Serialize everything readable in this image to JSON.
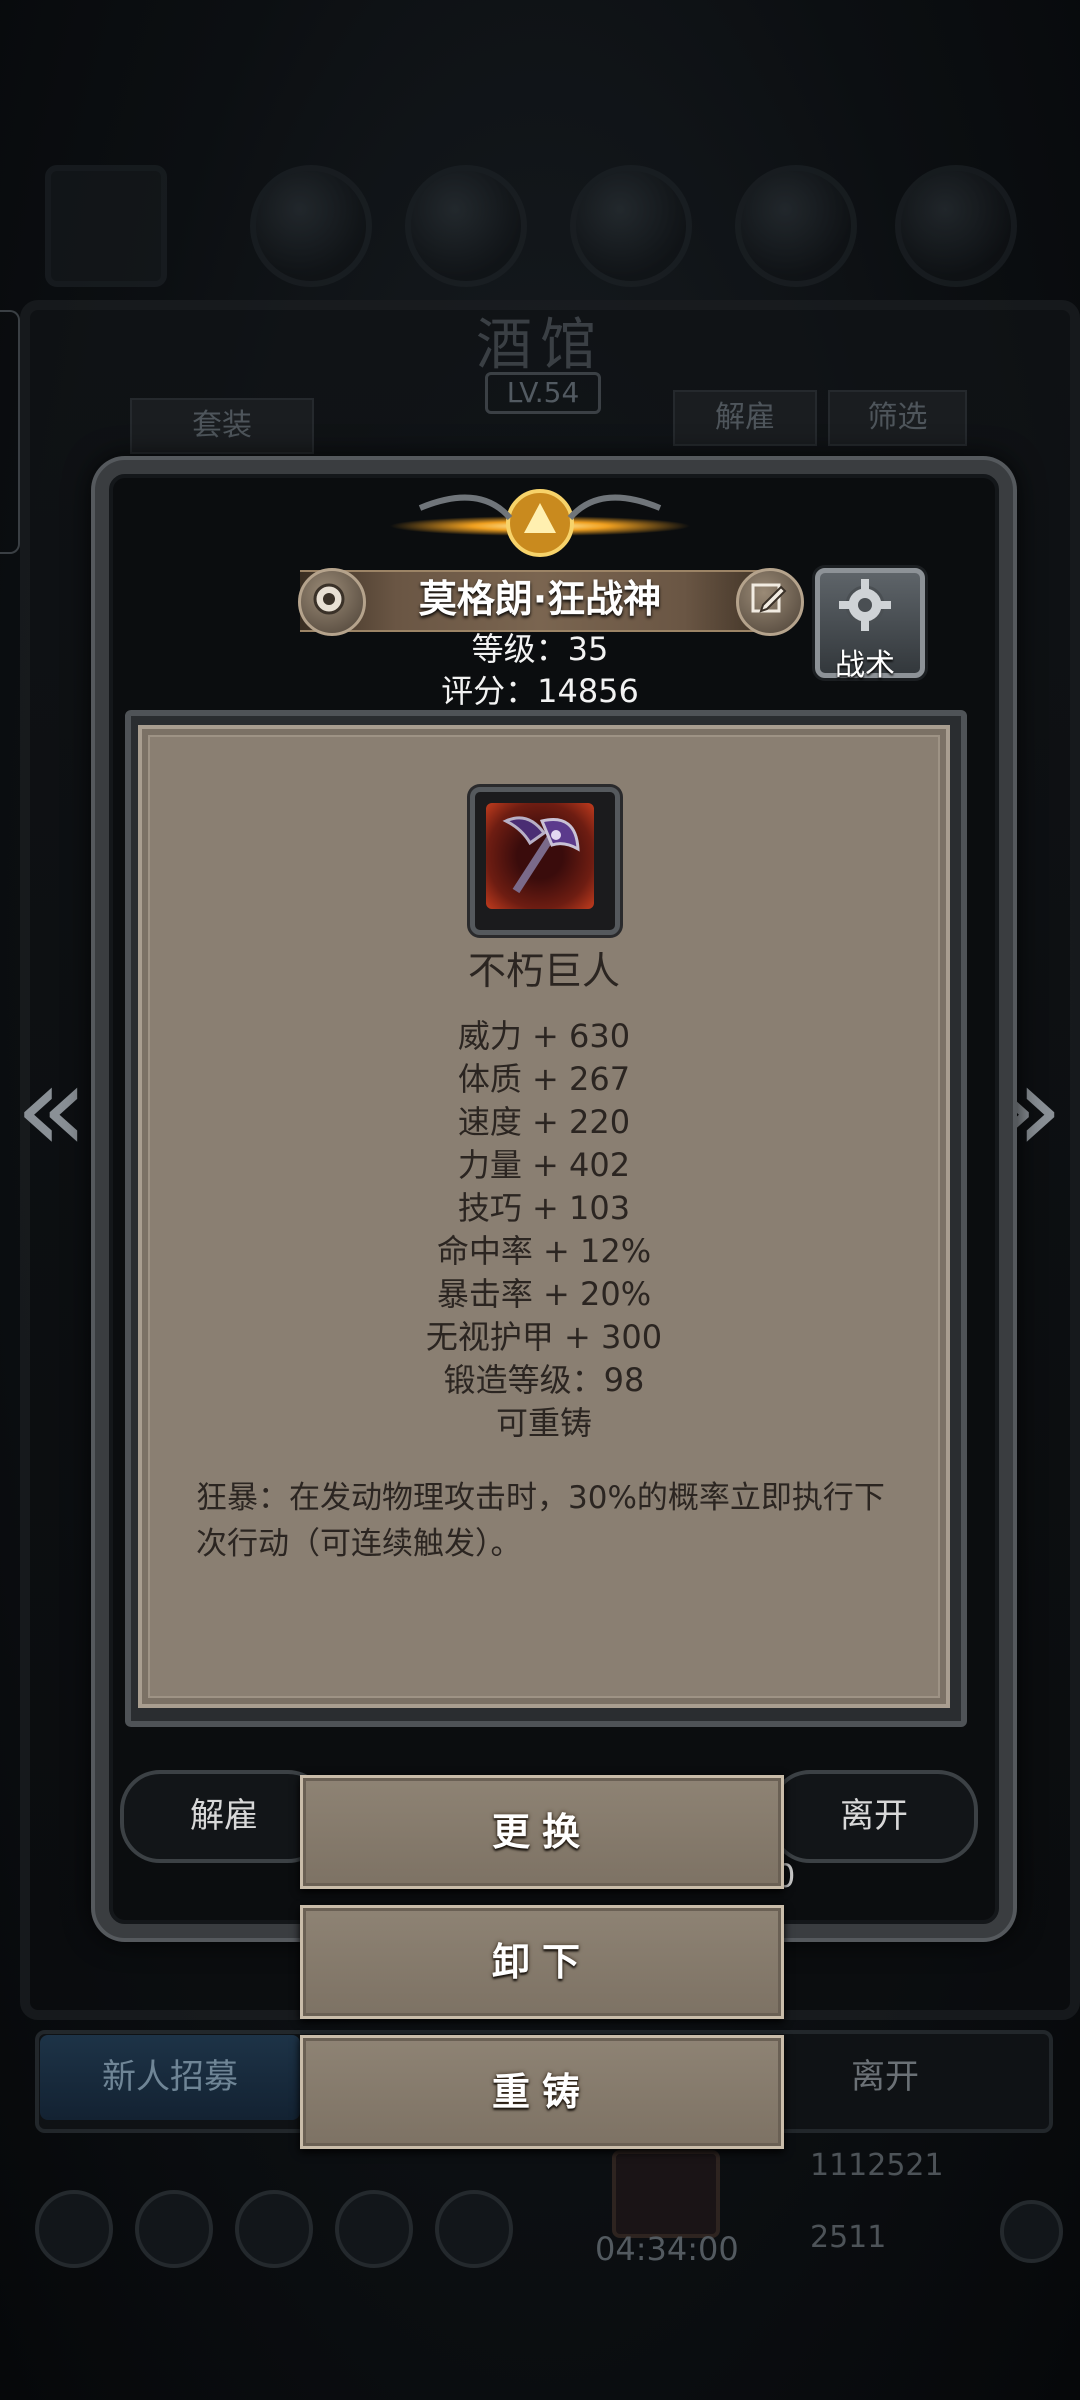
{
  "background": {
    "title": "酒馆",
    "level": "LV.54",
    "buttons": {
      "suit": "套装",
      "dismiss": "解雇",
      "filter": "筛选"
    },
    "recruit": "新人招募",
    "leave": "离开",
    "timer": "04:34:00",
    "gold": "1112521",
    "gems": "2511"
  },
  "hero": {
    "name": "莫格朗·狂战神",
    "level": "等级：35",
    "score": "评分：14856",
    "tactics_label": "战术"
  },
  "item": {
    "name": "不朽巨人",
    "icon": "battle-axe-icon",
    "stats": [
      "威力 + 630",
      "体质 + 267",
      "速度 + 220",
      "力量 + 402",
      "技巧 + 103",
      "命中率 + 12%",
      "暴击率 + 20%",
      "无视护甲 + 300",
      "锻造等级：98",
      "可重铸"
    ],
    "description": "狂暴：在发动物理攻击时，30%的概率立即执行下次行动（可连续触发）。"
  },
  "panel_buttons": {
    "dismiss": "解雇",
    "leave": "离开",
    "under_text": "0"
  },
  "actions": {
    "replace": "更换",
    "unequip": "卸下",
    "reforge": "重铸"
  },
  "colors": {
    "card_bg": "#8a7f72",
    "card_text": "#2b2521",
    "button_bg": "#8e8374"
  }
}
